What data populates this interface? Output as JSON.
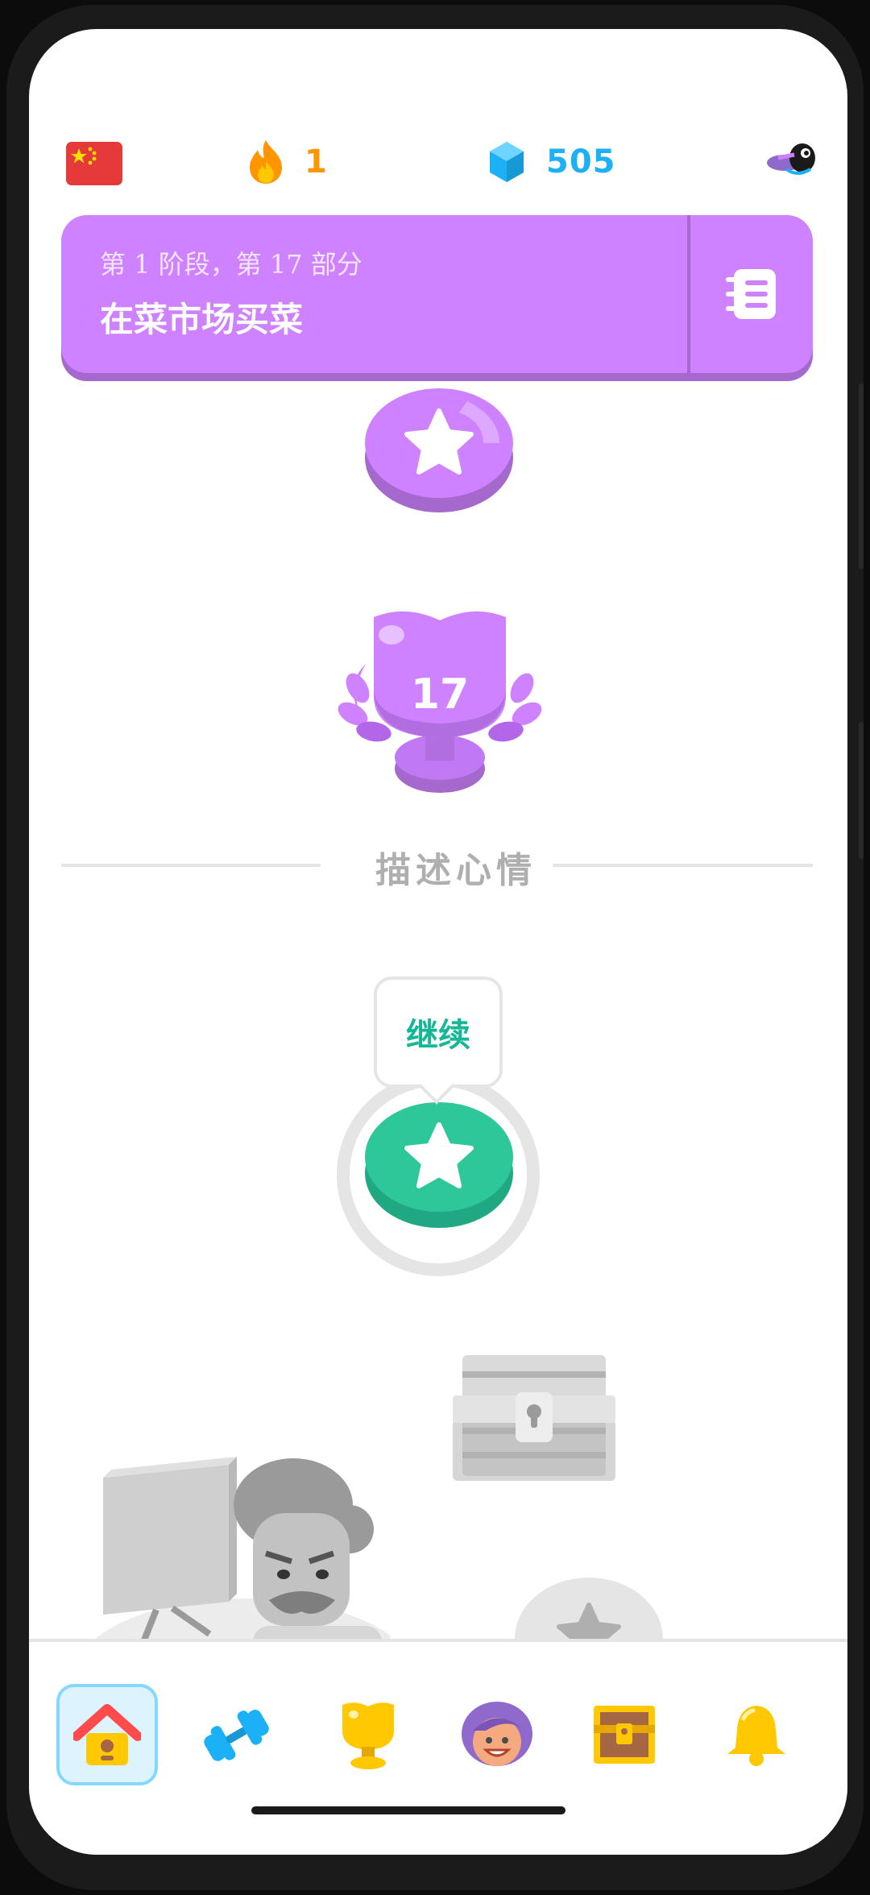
{
  "topbar": {
    "flag_icon": "china-flag-icon",
    "streak_count": "1",
    "gems_count": "505",
    "colors": {
      "streak": "#ff9600",
      "gems": "#1cb0f6"
    }
  },
  "unit": {
    "subtitle": "第 1 阶段，第 17 部分",
    "title": "在菜市场买菜",
    "guide_icon": "guidebook-icon",
    "color": "#ce82ff"
  },
  "path": {
    "trophy_number": "17",
    "section_label": "描述心情",
    "tooltip_label": "继续",
    "active_color": "#2ec79a"
  },
  "nav": {
    "items": [
      "home-icon",
      "practice-dumbbell-icon",
      "leaderboard-trophy-icon",
      "character-icon",
      "treasure-chest-icon",
      "notifications-bell-icon"
    ],
    "active_index": 0
  }
}
